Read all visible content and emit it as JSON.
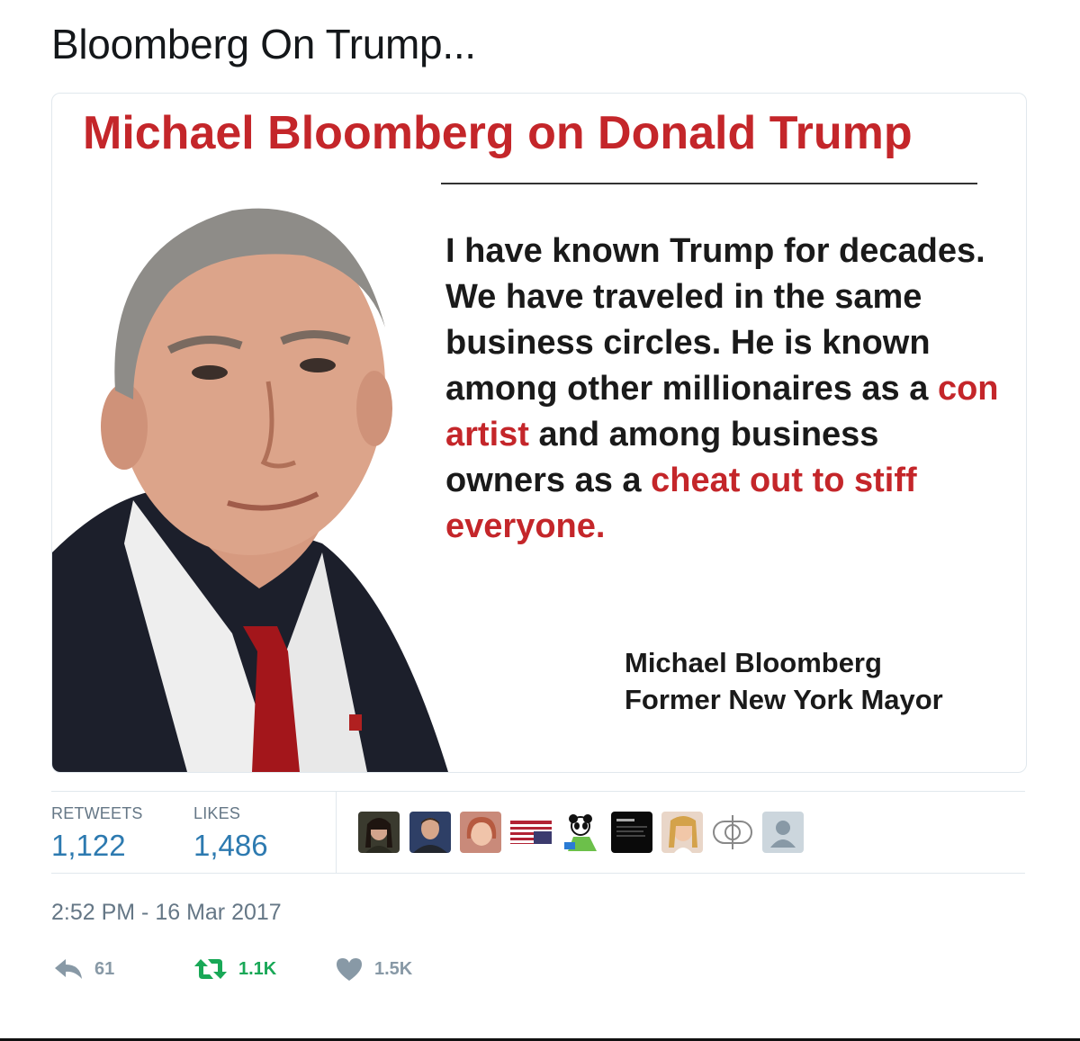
{
  "tweet": {
    "text": "Bloomberg On Trump...",
    "timestamp": "2:52 PM - 16 Mar 2017"
  },
  "media": {
    "title": "Michael Bloomberg on Donald Trump",
    "quote": {
      "part1": "I have known Trump for decades. We have traveled in the same business circles. He is known among other millionaires as a ",
      "highlight1": "con artist",
      "part2": " and among business owners as a ",
      "highlight2": "cheat out to stiff everyone."
    },
    "attribution": {
      "name": "Michael Bloomberg",
      "role": "Former New York Mayor"
    }
  },
  "stats": {
    "retweets_label": "RETWEETS",
    "retweets_value": "1,122",
    "likes_label": "LIKES",
    "likes_value": "1,486"
  },
  "likers": [
    "avatar-woman-dark-hair",
    "avatar-man",
    "avatar-woman-blonde",
    "avatar-upside-down-flag",
    "avatar-cartoon-panda",
    "avatar-dark-screenshot",
    "avatar-woman-selfie",
    "avatar-bubble-logo",
    "avatar-default-egg"
  ],
  "actions": {
    "reply_count": "61",
    "retweet_count": "1.1K",
    "like_count": "1.5K"
  },
  "colors": {
    "accent_red": "#c4262a",
    "stat_blue": "#2d7ab0",
    "retweet_green": "#19a857",
    "muted_gray": "#8899a6"
  }
}
